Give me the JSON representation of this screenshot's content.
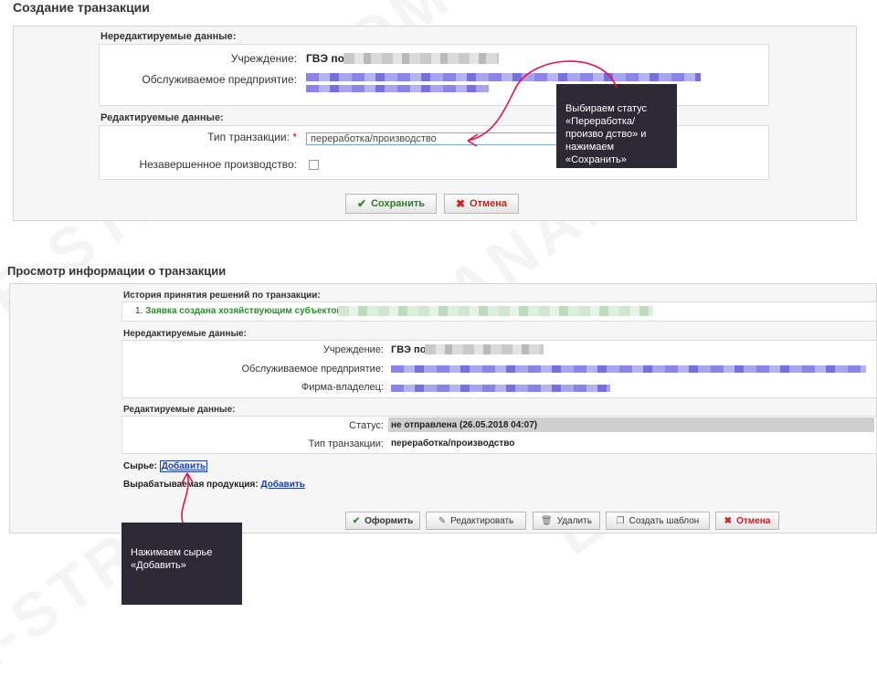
{
  "create": {
    "title": "Создание транзакции",
    "noneditable_label": "Нередактируемые данные:",
    "institution_label": "Учреждение:",
    "institution_value": "ГВЭ по",
    "enterprise_label": "Обслуживаемое предприятие:",
    "editable_label": "Редактируемые данные:",
    "type_label": "Тип транзакции:",
    "required_mark": "*",
    "type_value": "переработка/производство",
    "unfinished_label": "Незавершенное производство:",
    "save_label": "Сохранить",
    "cancel_label": "Отмена"
  },
  "view": {
    "title": "Просмотр информации о транзакции",
    "history_label": "История принятия решений по транзакции:",
    "history_item_number": "1.",
    "history_item_text": "Заявка создана хозяйствующим субъектом :",
    "noneditable_label": "Нередактируемые данные:",
    "institution_label": "Учреждение:",
    "institution_value": "ГВЭ по",
    "enterprise_label": "Обслуживаемое предприятие:",
    "owner_label": "Фирма-владелец:",
    "editable_label": "Редактируемые данные:",
    "status_label": "Статус:",
    "status_value": "не отправлена (26.05.2018 04:07)",
    "type_label": "Тип транзакции:",
    "type_value": "переработка/производство",
    "raw_label": "Сырье:",
    "raw_link": "Добавить",
    "product_label": "Вырабатываемая продукция:",
    "product_link": "Добавить",
    "buttons": {
      "finalize": "Оформить",
      "edit": "Редактировать",
      "delete": "Удалить",
      "template": "Создать шаблон",
      "cancel": "Отмена"
    }
  },
  "callouts": {
    "top": "Выбираем статус «Переработка/произво дство» и нажимаем «Сохранить»",
    "bottom": "Нажимаем сырье «Добавить»"
  },
  "watermark": "E-STRANA.COM",
  "colors": {
    "annotation_red": "#e0144c",
    "callout_bg": "#2d2a35",
    "history_green": "#2f8a2f",
    "link_blue": "#1a3faa"
  }
}
